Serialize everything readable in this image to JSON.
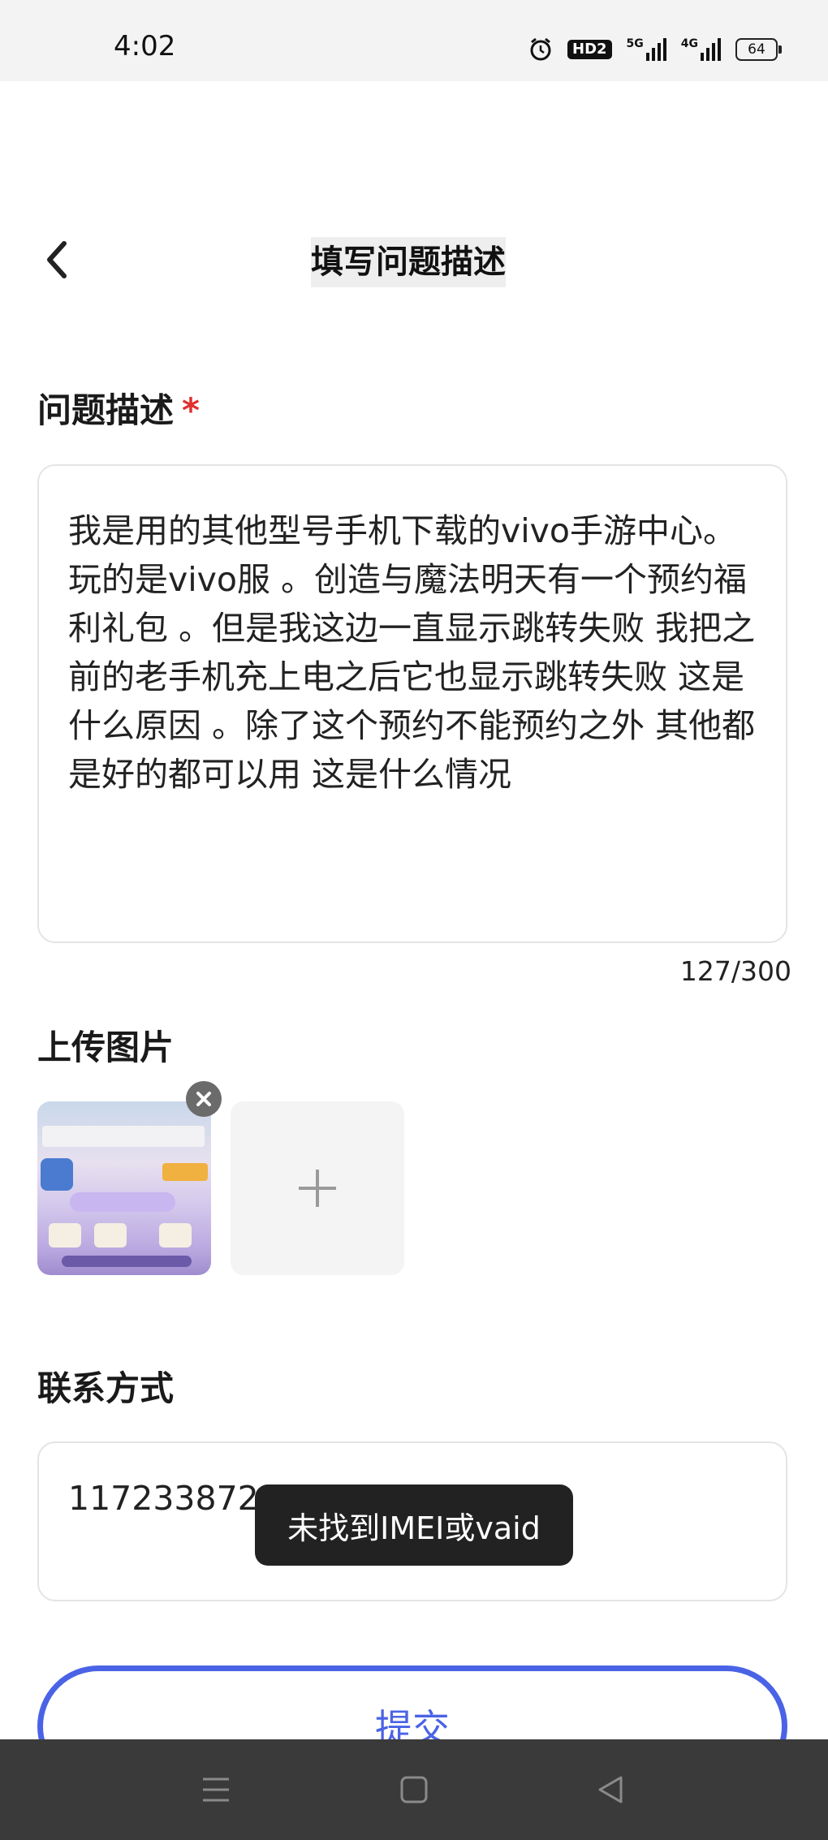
{
  "status_bar": {
    "time": "4:02",
    "hd_badge": "HD2",
    "network_1": "5G",
    "network_2": "4G",
    "battery": "64"
  },
  "header": {
    "title": "填写问题描述"
  },
  "description": {
    "label": "问题描述",
    "required_mark": "*",
    "text": "我是用的其他型号手机下载的vivo手游中心。玩的是vivo服 。创造与魔法明天有一个预约福利礼包 。但是我这边一直显示跳转失败 我把之前的老手机充上电之后它也显示跳转失败 这是什么原因 。除了这个预约不能预约之外 其他都是好的都可以用 这是什么情况",
    "counter": "127/300"
  },
  "upload": {
    "label": "上传图片",
    "add_icon": "plus-icon",
    "remove_icon": "close-icon"
  },
  "contact": {
    "label": "联系方式",
    "value": "1172338720"
  },
  "toast": {
    "message": "未找到IMEI或vaid"
  },
  "submit": {
    "label": "提交"
  },
  "nav": {
    "menu_icon": "menu-icon",
    "home_icon": "home-square-icon",
    "back_icon": "back-triangle-icon"
  },
  "colors": {
    "accent": "#4a63e6",
    "required": "#e03030",
    "toast_bg": "#222222",
    "nav_bg": "#3a3a3a"
  }
}
